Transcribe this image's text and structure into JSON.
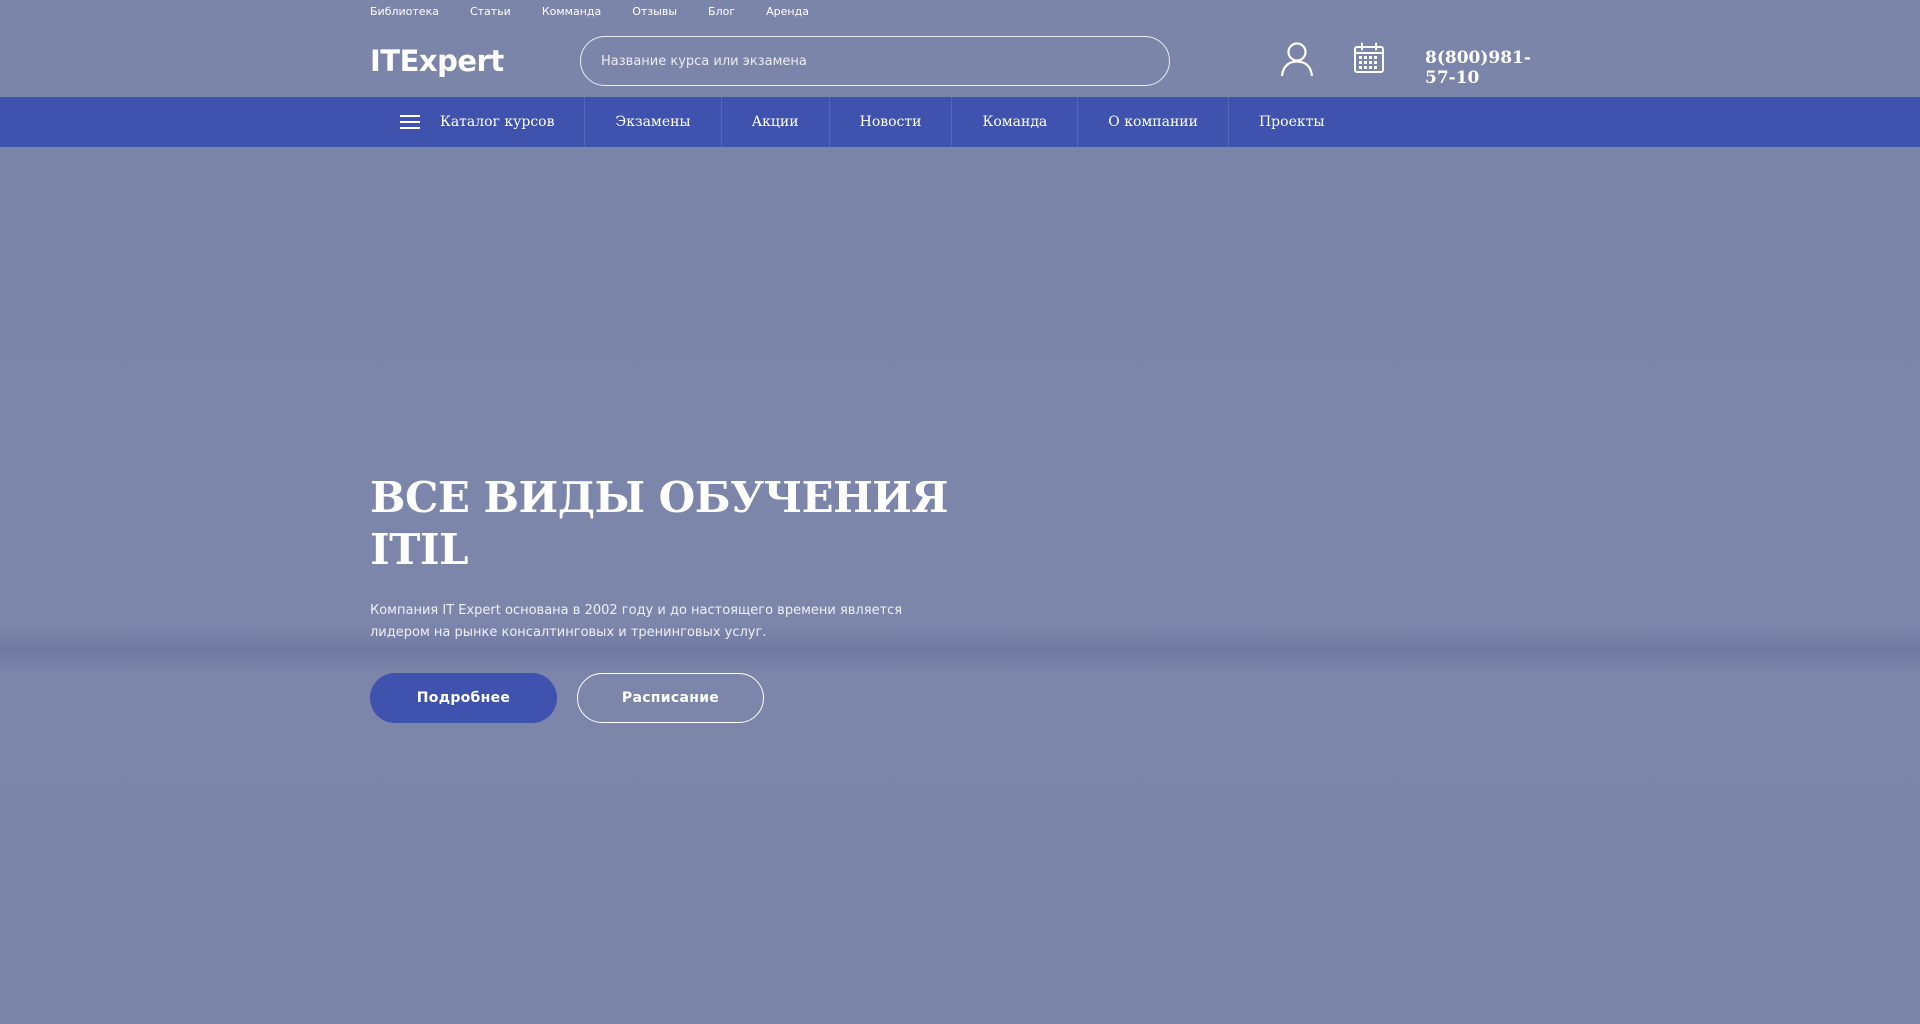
{
  "top_links": [
    "Библиотека",
    "Статьи",
    "Комманда",
    "Отзывы",
    "Блог",
    "Аренда"
  ],
  "header": {
    "logo": "ITExpert",
    "search_placeholder": "Название курса или экзамена",
    "user_icon": "user-icon",
    "calendar_icon": "calendar-icon",
    "phone": "8(800)981-57-10"
  },
  "nav": {
    "catalog_label": "Каталог курсов",
    "items": [
      "Экзамены",
      "Акции",
      "Новости",
      "Команда",
      "О компании",
      "Проекты"
    ]
  },
  "hero": {
    "title": "ВСЕ ВИДЫ ОБУЧЕНИЯ\nITIL",
    "text": "Компания IT Expert основана в 2002 году и до настоящего времени является лидером на рынке консалтинговых и тренинговых услуг.",
    "primary_button": "Подробнее",
    "secondary_button": "Расписание"
  },
  "colors": {
    "background": "#7b84a9",
    "accent": "#3e52ae",
    "text": "#ffffff"
  }
}
